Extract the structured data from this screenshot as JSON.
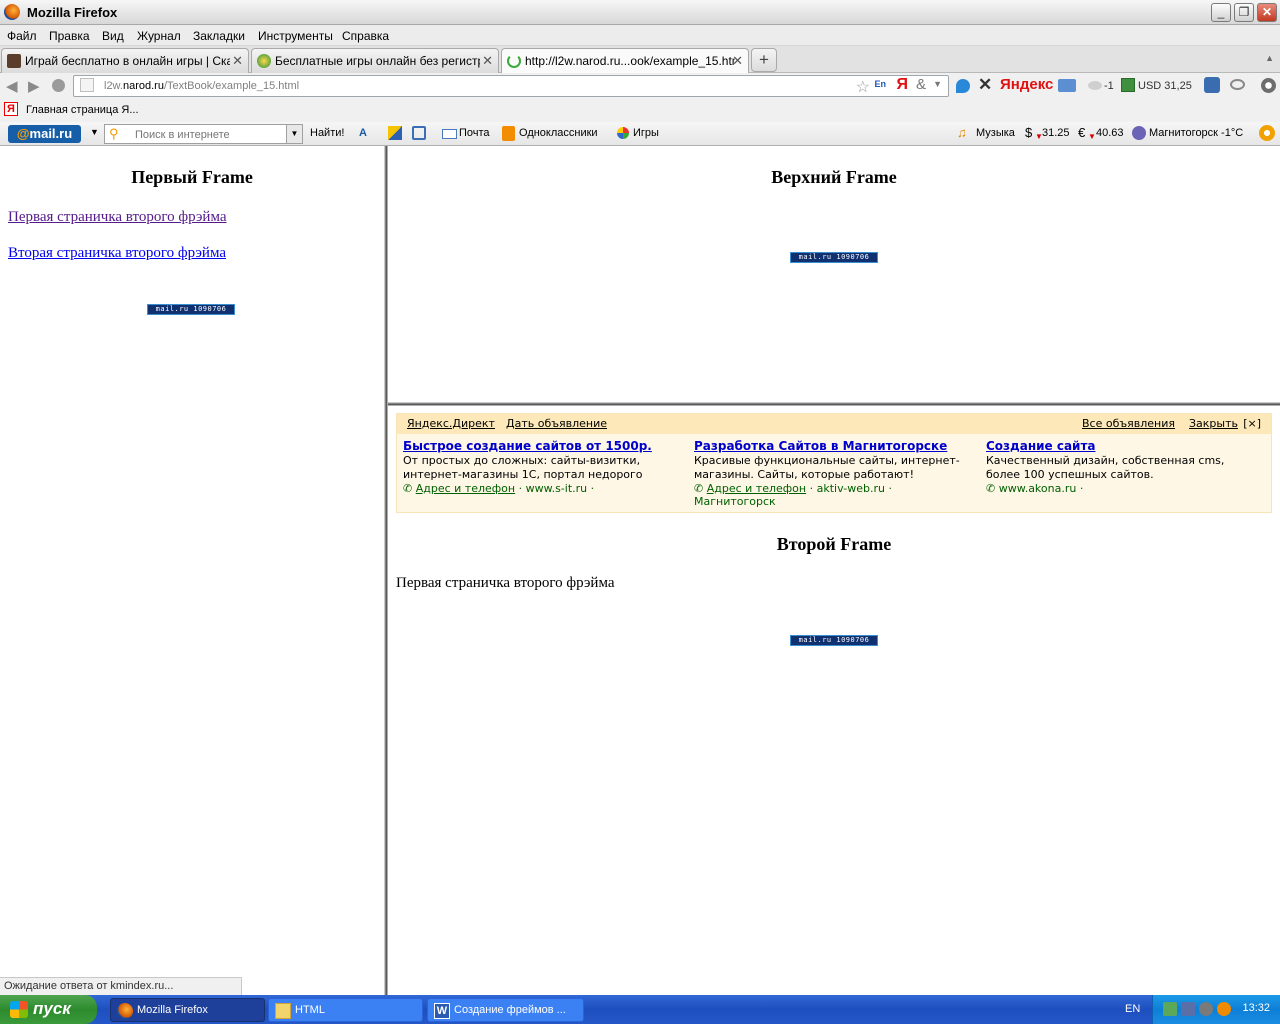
{
  "window": {
    "title": "Mozilla Firefox",
    "min_glyph": "_",
    "max_glyph": "❐",
    "close_glyph": "✕"
  },
  "menu": [
    "Файл",
    "Правка",
    "Вид",
    "Журнал",
    "Закладки",
    "Инструменты",
    "Справка"
  ],
  "tabs": [
    {
      "label": "Играй бесплатно в онлайн игры | Скач...",
      "close": "✕"
    },
    {
      "label": "Бесплатные игры онлайн без регистра...",
      "close": "✕"
    },
    {
      "label": "http://l2w.narod.ru...ook/example_15.html",
      "close": "✕"
    }
  ],
  "newtab_glyph": "+",
  "tab_scroll_glyph": "▲",
  "nav": {
    "back_glyph": "◀",
    "forward_glyph": "▶",
    "url_prefix": "l2w.",
    "url_domain": "narod.ru",
    "url_path": "/TextBook/example_15.html",
    "star_glyph": "☆",
    "en_label": "En",
    "ya_label": "Я",
    "amp_label": "&",
    "dropdown_glyph": "▼",
    "yandex_label": "Яндекс",
    "weather": "-1",
    "currency": "USD 31,25",
    "stop_glyph": "✕"
  },
  "bookmarks": {
    "icon_letter": "Я",
    "label": "Главная страница Я..."
  },
  "mailru_toolbar": {
    "logo_at": "@",
    "logo_text": "mail.ru",
    "search_placeholder": "Поиск в интернете",
    "find_label": "Найти!",
    "mail_label": "Почта",
    "ok_label": "Одноклассники",
    "games_label": "Игры",
    "music_label": "Музыка",
    "usd": "31.25",
    "eur": "40.63",
    "weather": "Магнитогорск -1°C",
    "usd_symbol": "$",
    "eur_symbol": "€"
  },
  "frame_left": {
    "heading": "Первый Frame",
    "link1": "Первая страничка второго фрэйма",
    "link2": "Вторая страничка второго фрэйма",
    "counter": "mail.ru  1090706"
  },
  "frame_top": {
    "heading": "Верхний Frame",
    "counter": "mail.ru  1090706"
  },
  "frame_bottom": {
    "ydirect": {
      "brand": "Яндекс.Директ",
      "post_ad": "Дать объявление",
      "all_ads": "Все объявления",
      "close": "Закрыть",
      "close_x": "[×]",
      "ads": [
        {
          "title": "Быстрое создание сайтов от 1500р.",
          "text": "От простых до сложных: сайты-визитки, интернет-магазины 1С, портал недорого",
          "address": "Адрес и телефон",
          "site": "www.s-it.ru",
          "city": ""
        },
        {
          "title": "Разработка Сайтов в Магнитогорске",
          "text": "Красивые функциональные сайты, интернет-магазины. Сайты, которые работают!",
          "address": "Адрес и телефон",
          "site": "aktiv-web.ru",
          "city": "Магнитогорск"
        },
        {
          "title": "Создание сайта",
          "text": "Качественный дизайн, собственная cms, более 100 успешных сайтов.",
          "address": "",
          "site": "www.akona.ru",
          "city": ""
        }
      ]
    },
    "heading": "Второй Frame",
    "text": "Первая страничка второго фрэйма",
    "counter": "mail.ru  1090706"
  },
  "status": "Ожидание ответа от kmindex.ru...",
  "taskbar": {
    "start": "пуск",
    "items": [
      "Mozilla Firefox",
      "HTML",
      "Создание фреймов ..."
    ],
    "lang": "EN",
    "time": "13:32"
  }
}
